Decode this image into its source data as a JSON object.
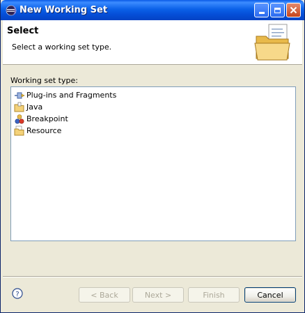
{
  "window": {
    "title": "New Working Set"
  },
  "banner": {
    "title": "Select",
    "description": "Select a working set type."
  },
  "body": {
    "label": "Working set type:",
    "items": [
      {
        "label": "Plug-ins and Fragments",
        "icon": "plugin-icon"
      },
      {
        "label": "Java",
        "icon": "java-folder-icon"
      },
      {
        "label": "Breakpoint",
        "icon": "breakpoint-icon"
      },
      {
        "label": "Resource",
        "icon": "resource-folder-icon"
      }
    ]
  },
  "buttons": {
    "back": "< Back",
    "next": "Next >",
    "finish": "Finish",
    "cancel": "Cancel"
  },
  "colors": {
    "titlebar": "#0A5AE6",
    "dialog_bg": "#ECE9D8",
    "tree_border": "#7F9DB9"
  }
}
